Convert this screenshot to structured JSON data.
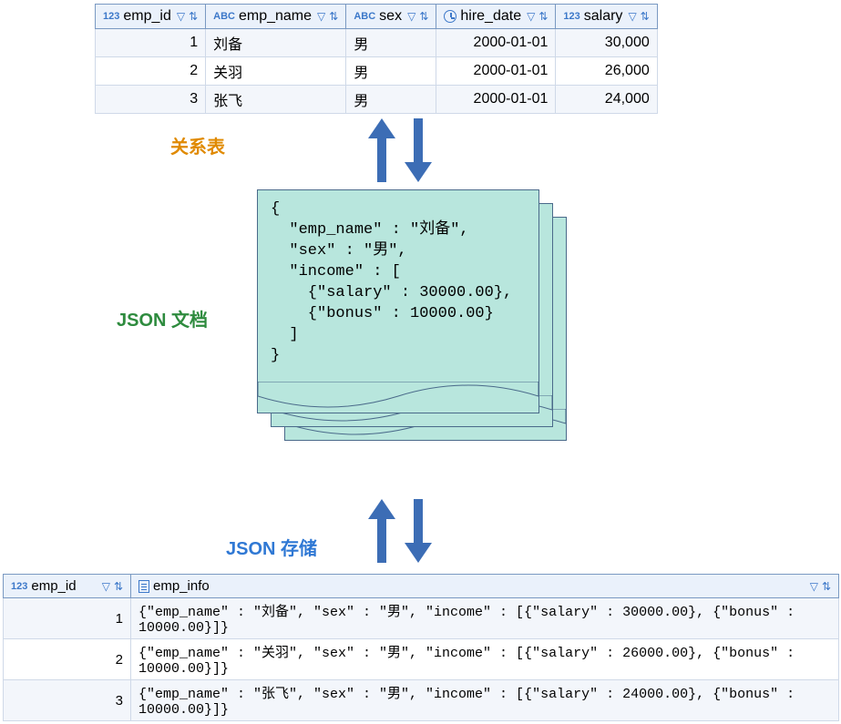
{
  "labels": {
    "relational_table": "关系表",
    "json_doc": "JSON 文档",
    "json_store": "JSON 存储"
  },
  "table1": {
    "columns": {
      "emp_id": "emp_id",
      "emp_name": "emp_name",
      "sex": "sex",
      "hire_date": "hire_date",
      "salary": "salary"
    },
    "col_type_prefix": {
      "num": "123",
      "text": "ABC",
      "text_search": "ABC"
    },
    "rows": [
      {
        "emp_id": "1",
        "emp_name": "刘备",
        "sex": "男",
        "hire_date": "2000-01-01",
        "salary": "30,000"
      },
      {
        "emp_id": "2",
        "emp_name": "关羽",
        "sex": "男",
        "hire_date": "2000-01-01",
        "salary": "26,000"
      },
      {
        "emp_id": "3",
        "emp_name": "张飞",
        "sex": "男",
        "hire_date": "2000-01-01",
        "salary": "24,000"
      }
    ]
  },
  "json_doc_text": "{\n  \"emp_name\" : \"刘备\",\n  \"sex\" : \"男\",\n  \"income\" : [\n    {\"salary\" : 30000.00},\n    {\"bonus\" : 10000.00}\n  ]\n}",
  "table2": {
    "columns": {
      "emp_id": "emp_id",
      "emp_info": "emp_info"
    },
    "rows": [
      {
        "emp_id": "1",
        "emp_info": "{\"emp_name\" : \"刘备\", \"sex\" : \"男\", \"income\" : [{\"salary\" : 30000.00}, {\"bonus\" : 10000.00}]}"
      },
      {
        "emp_id": "2",
        "emp_info": "{\"emp_name\" : \"关羽\", \"sex\" : \"男\", \"income\" : [{\"salary\" : 26000.00}, {\"bonus\" : 10000.00}]}"
      },
      {
        "emp_id": "3",
        "emp_info": "{\"emp_name\" : \"张飞\", \"sex\" : \"男\", \"income\" : [{\"salary\" : 24000.00}, {\"bonus\" : 10000.00}]}"
      }
    ]
  },
  "chart_data": {
    "type": "table",
    "title": "Relational table ↔ JSON document ↔ JSON storage mapping",
    "relational_rows": [
      {
        "emp_id": 1,
        "emp_name": "刘备",
        "sex": "男",
        "hire_date": "2000-01-01",
        "salary": 30000
      },
      {
        "emp_id": 2,
        "emp_name": "关羽",
        "sex": "男",
        "hire_date": "2000-01-01",
        "salary": 26000
      },
      {
        "emp_id": 3,
        "emp_name": "张飞",
        "sex": "男",
        "hire_date": "2000-01-01",
        "salary": 24000
      }
    ],
    "sample_json_document": {
      "emp_name": "刘备",
      "sex": "男",
      "income": [
        {
          "salary": 30000.0
        },
        {
          "bonus": 10000.0
        }
      ]
    },
    "json_storage_rows": [
      {
        "emp_id": 1,
        "emp_info": {
          "emp_name": "刘备",
          "sex": "男",
          "income": [
            {
              "salary": 30000.0
            },
            {
              "bonus": 10000.0
            }
          ]
        }
      },
      {
        "emp_id": 2,
        "emp_info": {
          "emp_name": "关羽",
          "sex": "男",
          "income": [
            {
              "salary": 26000.0
            },
            {
              "bonus": 10000.0
            }
          ]
        }
      },
      {
        "emp_id": 3,
        "emp_info": {
          "emp_name": "张飞",
          "sex": "男",
          "income": [
            {
              "salary": 24000.0
            },
            {
              "bonus": 10000.0
            }
          ]
        }
      }
    ]
  }
}
